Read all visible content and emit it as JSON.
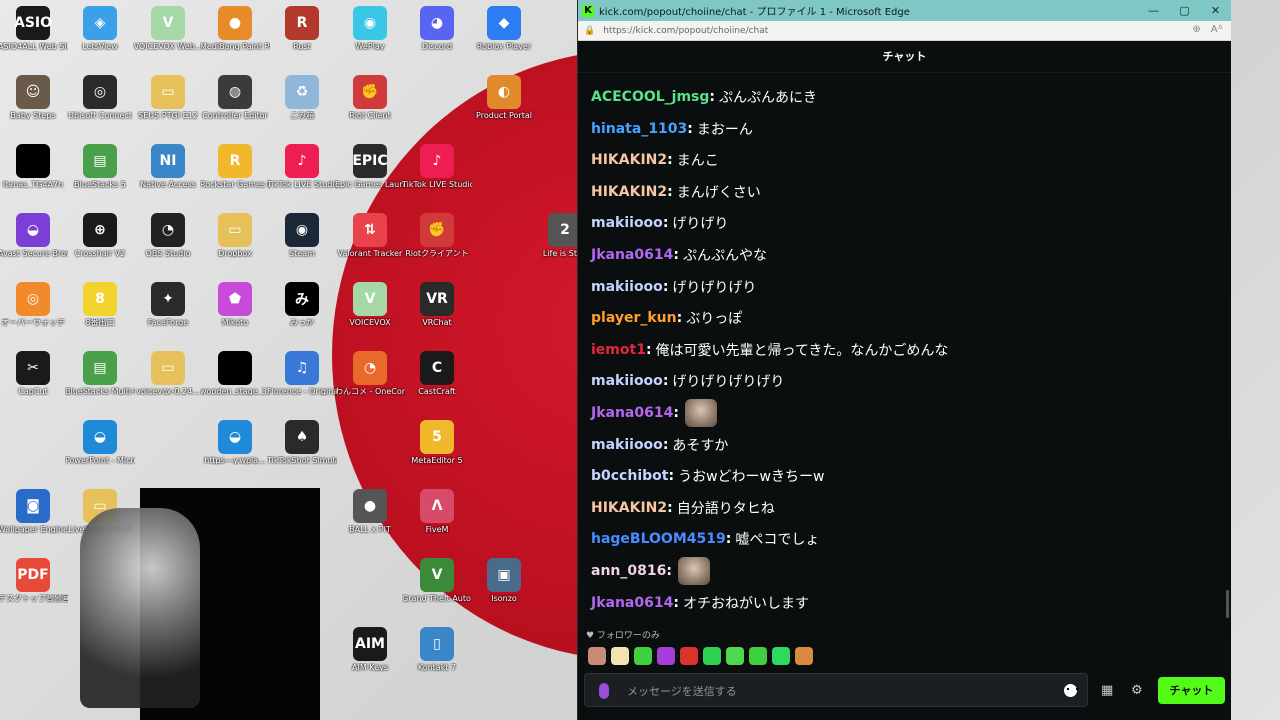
{
  "window": {
    "title": "kick.com/popout/choiine/chat - プロファイル 1 - Microsoft Edge",
    "url": "https://kick.com/popout/choiine/chat",
    "favicon_letter": "K",
    "minimize": "—",
    "maximize": "▢",
    "close": "✕"
  },
  "chat": {
    "header": "チャット",
    "messages": [
      {
        "user": "ACECOOL_jmsg",
        "color": "#57e389",
        "text": "ぷんぷんあにき"
      },
      {
        "user": "hinata_1103",
        "color": "#4aa0ff",
        "text": "まおーん"
      },
      {
        "user": "HIKAKIN2",
        "color": "#f7c6a3",
        "text": "まんこ"
      },
      {
        "user": "HIKAKIN2",
        "color": "#f7c6a3",
        "text": "まんげくさい"
      },
      {
        "user": "makiiooo",
        "color": "#c2d4ff",
        "text": "げりげり"
      },
      {
        "user": "Jkana0614",
        "color": "#b267f0",
        "text": "ぷんぷんやな"
      },
      {
        "user": "makiiooo",
        "color": "#c2d4ff",
        "text": "げりげりげり"
      },
      {
        "user": "player_kun",
        "color": "#ff9f2e",
        "text": "ぶりっぽ"
      },
      {
        "user": "iemot1",
        "color": "#e3283e",
        "text": "俺は可愛い先輩と帰ってきた。なんかごめんな"
      },
      {
        "user": "makiiooo",
        "color": "#c2d4ff",
        "text": "げりげりげりげり"
      },
      {
        "user": "Jkana0614",
        "color": "#b267f0",
        "text": ""
      },
      {
        "user": "makiiooo",
        "color": "#c2d4ff",
        "text": "あそすか"
      },
      {
        "user": "b0cchibot",
        "color": "#c2d4ff",
        "text": "うおwどわーwきちーw"
      },
      {
        "user": "HIKAKIN2",
        "color": "#f7c6a3",
        "text": "自分語りタヒね"
      },
      {
        "user": "hageBLOOM4519",
        "color": "#4a8cff",
        "text": "嘘ペコでしょ"
      },
      {
        "user": "ann_0816",
        "color": "#f2d3e6",
        "text": ""
      },
      {
        "user": "Jkana0614",
        "color": "#b267f0",
        "text": "オチおねがいします"
      }
    ],
    "followers_only": "♥ フォロワーのみ",
    "input_placeholder": "メッセージを送信する",
    "send_label": "チャット",
    "accent": "#53fc18"
  },
  "desktop": {
    "icons": [
      {
        "label": "ASIO4ALL Web Site",
        "color": "#1a1a1a",
        "glyph": "ASIO"
      },
      {
        "label": "LetsView",
        "color": "#3aa0e8",
        "glyph": "◈"
      },
      {
        "label": "VOICEVOX Web...",
        "color": "#a6d7a6",
        "glyph": "V"
      },
      {
        "label": "MediBang Paint Pro",
        "color": "#e88b2b",
        "glyph": "●"
      },
      {
        "label": "Rust",
        "color": "#b2392c",
        "glyph": "R"
      },
      {
        "label": "WePlay",
        "color": "#39c7e8",
        "glyph": "◉"
      },
      {
        "label": "Discord",
        "color": "#5865f2",
        "glyph": "◕"
      },
      {
        "label": "Roblox Player",
        "color": "#2c7cf2",
        "glyph": "◆"
      },
      {
        "label": "Baby Steps",
        "color": "#6a5a4a",
        "glyph": "☺"
      },
      {
        "label": "Ubisoft Connect",
        "color": "#2b2b2b",
        "glyph": "◎"
      },
      {
        "label": "SEUS PTGI E12",
        "color": "#e6c15a",
        "glyph": "▭"
      },
      {
        "label": "Controller Editor",
        "color": "#3b3b3b",
        "glyph": "◍"
      },
      {
        "label": "ごみ箱",
        "color": "#8fb7d9",
        "glyph": "♻"
      },
      {
        "label": "Riot Client",
        "color": "#d13a3a",
        "glyph": "✊"
      },
      {
        "label": "Product Portal",
        "color": "#e08a2b",
        "glyph": "◐"
      },
      {
        "label": "Itanas_TG4A7n",
        "color": "#000000",
        "glyph": ""
      },
      {
        "label": "BlueStacks 5",
        "color": "#4aa04a",
        "glyph": "▤"
      },
      {
        "label": "Native Access",
        "color": "#3a86c8",
        "glyph": "NI"
      },
      {
        "label": "Rockstar Games Launcher",
        "color": "#f2b82c",
        "glyph": "R"
      },
      {
        "label": "TikTok LIVE Studio",
        "color": "#ee1d52",
        "glyph": "♪"
      },
      {
        "label": "Epic Games Launcher",
        "color": "#2b2b2b",
        "glyph": "EPIC"
      },
      {
        "label": "TikTok LIVE Studio",
        "color": "#ee1d52",
        "glyph": "♪"
      },
      {
        "label": "Avast Secure Browser",
        "color": "#7b3fd8",
        "glyph": "◒"
      },
      {
        "label": "Crosshair V2",
        "color": "#1a1a1a",
        "glyph": "⊕"
      },
      {
        "label": "OBS Studio",
        "color": "#222222",
        "glyph": "◔"
      },
      {
        "label": "Dropbox",
        "color": "#e6c15a",
        "glyph": "▭"
      },
      {
        "label": "Steam",
        "color": "#1b2838",
        "glyph": "◉"
      },
      {
        "label": "Valorant Tracker",
        "color": "#e8434a",
        "glyph": "⇅"
      },
      {
        "label": "Riotクライアント",
        "color": "#d13a3a",
        "glyph": "✊"
      },
      {
        "label": "Life is Str...",
        "color": "#555555",
        "glyph": "2"
      },
      {
        "label": "オーバーウォッチ",
        "color": "#f08a2b",
        "glyph": "◎"
      },
      {
        "label": "8番出口",
        "color": "#f2d22c",
        "glyph": "8"
      },
      {
        "label": "FaceForge",
        "color": "#2a2a2a",
        "glyph": "✦"
      },
      {
        "label": "Mikoto",
        "color": "#c84ad8",
        "glyph": "⬟"
      },
      {
        "label": "みっか",
        "color": "#000000",
        "glyph": "み"
      },
      {
        "label": "VOICEVOX",
        "color": "#a6d7a6",
        "glyph": "V"
      },
      {
        "label": "VRChat",
        "color": "#2a2a2a",
        "glyph": "VR"
      },
      {
        "label": "CapCut",
        "color": "#1a1a1a",
        "glyph": "✂"
      },
      {
        "label": "BlueStacks Multi-Instance",
        "color": "#4aa04a",
        "glyph": "▤"
      },
      {
        "label": "voicevox-0.24...",
        "color": "#e6c15a",
        "glyph": "▭"
      },
      {
        "label": "wooden_stage_3...",
        "color": "#000000",
        "glyph": ""
      },
      {
        "label": "Florence - Original S...",
        "color": "#3a78d8",
        "glyph": "♫"
      },
      {
        "label": "わんコメ - OneComme",
        "color": "#e86a2b",
        "glyph": "◔"
      },
      {
        "label": "CastCraft",
        "color": "#1a1a1a",
        "glyph": "C"
      },
      {
        "label": "PowerPoint - Microsoft 365",
        "color": "#1f8ad8",
        "glyph": "◒"
      },
      {
        "label": "https---y.wpla...",
        "color": "#1f8ad8",
        "glyph": "◒"
      },
      {
        "label": "TikTokShot Simulator",
        "color": "#2a2a2a",
        "glyph": "♠"
      },
      {
        "label": "MetaEditor 5",
        "color": "#f2b82c",
        "glyph": "5"
      },
      {
        "label": "Wallpaper Engine",
        "color": "#2a6ac8",
        "glyph": "◙"
      },
      {
        "label": "LiveSplit_1.8.29",
        "color": "#e6c15a",
        "glyph": "▭"
      },
      {
        "label": "BALL x PIT",
        "color": "#555555",
        "glyph": "●"
      },
      {
        "label": "FiveM",
        "color": "#d84a6a",
        "glyph": "Λ"
      },
      {
        "label": "デスクトップ背景画像...",
        "color": "#e84a3a",
        "glyph": "PDF"
      },
      {
        "label": "Grand Theft Auto V",
        "color": "#3a8a3a",
        "glyph": "V"
      },
      {
        "label": "Isonzo",
        "color": "#4a6a8a",
        "glyph": "▣"
      },
      {
        "label": "AIM Keys",
        "color": "#1a1a1a",
        "glyph": "AIM"
      },
      {
        "label": "Kontakt 7",
        "color": "#3a86c8",
        "glyph": "▯"
      }
    ]
  }
}
